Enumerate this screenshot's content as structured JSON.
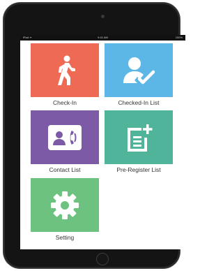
{
  "status_bar": {
    "carrier": "iPad ᯤ",
    "time": "9:41 AM",
    "battery": "100%"
  },
  "tiles": [
    {
      "label": "Check-In",
      "color": "#ee6a55",
      "icon": "walking-person-icon"
    },
    {
      "label": "Checked-In List",
      "color": "#5cb7e6",
      "icon": "user-check-icon"
    },
    {
      "label": "Contact List",
      "color": "#7d5aa6",
      "icon": "contact-card-phone-icon"
    },
    {
      "label": "Pre-Register List",
      "color": "#4fb49a",
      "icon": "document-add-icon"
    },
    {
      "label": "Setting",
      "color": "#6dc27f",
      "icon": "gear-icon"
    }
  ]
}
